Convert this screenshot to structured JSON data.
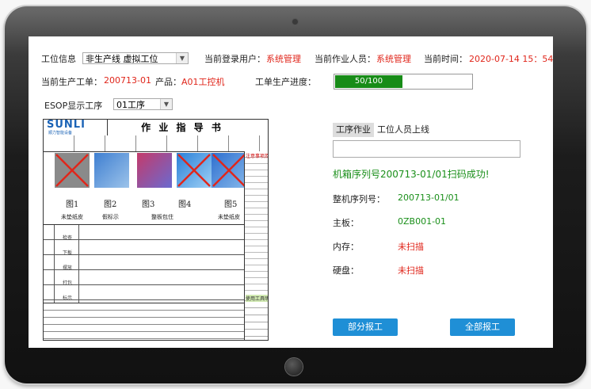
{
  "header": {
    "station_label": "工位信息",
    "station_value": "非生产线 虚拟工位",
    "login_user_label": "当前登录用户：",
    "login_user_value": "系统管理",
    "operator_label": "当前作业人员：",
    "operator_value": "系统管理",
    "time_label": "当前时间：",
    "time_value": "2020-07-14 15：54"
  },
  "order": {
    "order_label": "当前生产工单：",
    "order_value": "200713-01",
    "product_label": "产品：",
    "product_value": "A01工控机",
    "progress_label": "工单生产进度：",
    "progress_text": "50/100",
    "progress_fraction": 0.5
  },
  "esop": {
    "label": "ESOP显示工序",
    "value": "01工序"
  },
  "document": {
    "logo": "SUNLI",
    "logo_sub": "顺力智能设备",
    "title": "作 业 指 导 书",
    "fig_labels": [
      "图1",
      "图2",
      "图3",
      "图4",
      "图5"
    ],
    "caption_labels": [
      "未垫纸皮",
      "假标示",
      "整板包住",
      "未垫纸皮"
    ],
    "step_rows": [
      "检查",
      "下板",
      "摆放",
      "打包",
      "标示"
    ],
    "note_title": "注意事项及异常情况处理办法",
    "tool_title": "使用工具明细表"
  },
  "panel": {
    "tabs": [
      "工序作业",
      "工位人员上线"
    ],
    "scan_input_value": "",
    "scan_message": "机箱序列号200713-01/01扫码成功!",
    "serial_label": "整机序列号：",
    "serial_value": "200713-01/01",
    "board_label": "主板：",
    "board_value": "0ZB001-01",
    "memory_label": "内存：",
    "memory_value": "未扫描",
    "disk_label": "硬盘：",
    "disk_value": "未扫描",
    "partial_button": "部分报工",
    "all_button": "全部报工"
  },
  "colors": {
    "accent_red": "#e0261b",
    "success_green": "#1a8f1a",
    "progress_green": "#188c18",
    "button_blue": "#1f8fd6"
  }
}
